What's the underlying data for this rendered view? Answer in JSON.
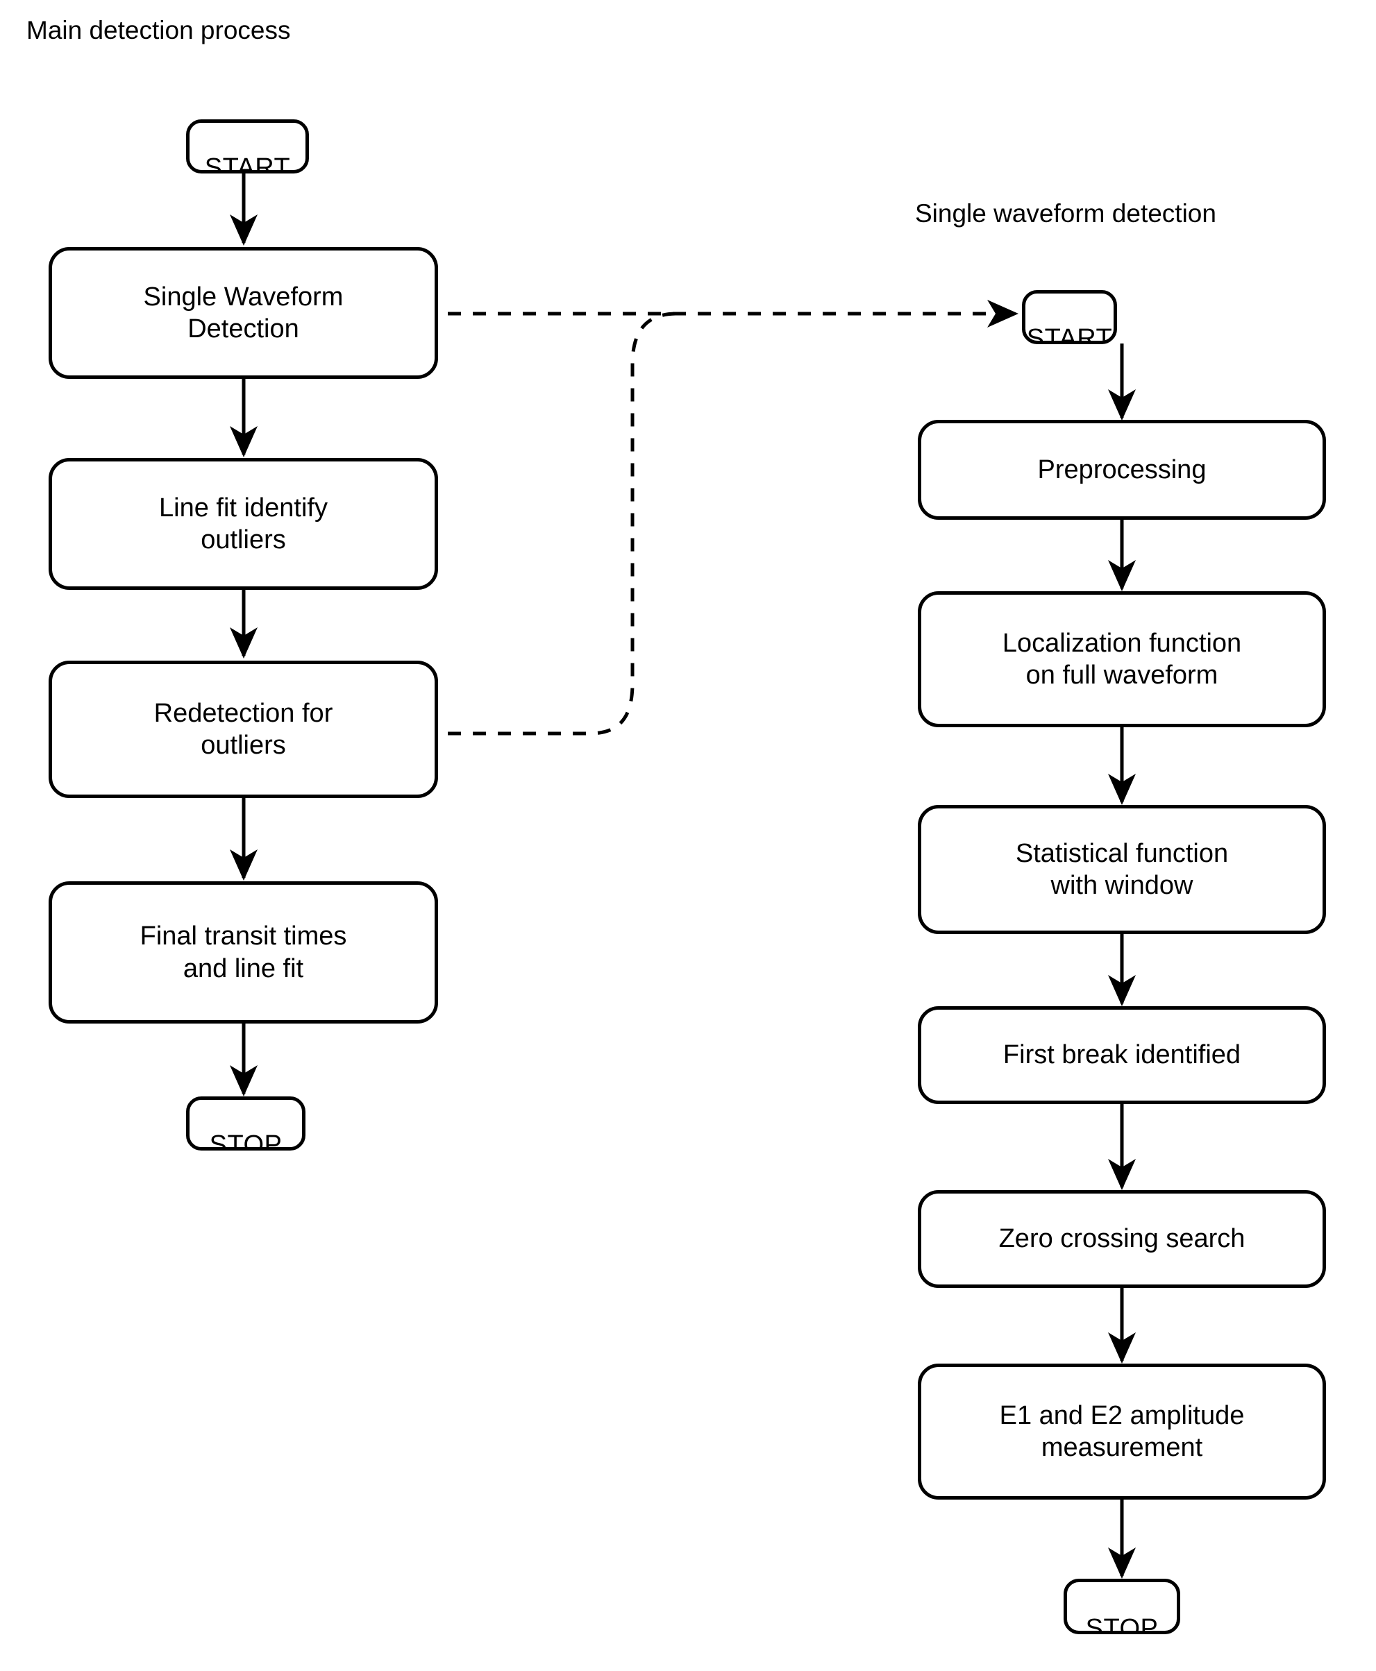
{
  "diagram": {
    "titles": {
      "main": "Main detection process",
      "right": "Single waveform detection"
    },
    "left_column": {
      "start": "START",
      "nodes": [
        {
          "id": "single-waveform-detection",
          "line1": "Single Waveform",
          "line2": "Detection"
        },
        {
          "id": "line-fit-identify-outliers",
          "line1": "Line fit identify",
          "line2": "outliers"
        },
        {
          "id": "redetection-for-outliers",
          "line1": "Redetection for",
          "line2": "outliers"
        },
        {
          "id": "final-transit-times-and-line-fit",
          "line1": "Final transit times",
          "line2": "and line fit"
        }
      ],
      "stop": "STOP"
    },
    "right_column": {
      "start": "START",
      "nodes": [
        {
          "id": "preprocessing",
          "line1": "Preprocessing",
          "line2": ""
        },
        {
          "id": "localization-function-on-full-waveform",
          "line1": "Localization function",
          "line2": "on full waveform"
        },
        {
          "id": "statistical-function-with-window",
          "line1": "Statistical function",
          "line2": "with window"
        },
        {
          "id": "first-break-identified",
          "line1": "First break identified",
          "line2": ""
        },
        {
          "id": "zero-crossing-search",
          "line1": "Zero crossing search",
          "line2": ""
        },
        {
          "id": "e1-and-e2-amplitude-measurement",
          "line1": "E1 and E2 amplitude",
          "line2": "measurement"
        }
      ],
      "stop": "STOP"
    },
    "connectors": {
      "style_solid": "solid-arrow",
      "style_dashed": "dashed-arrow",
      "dashed_call_label": "",
      "dashed_return_label": ""
    },
    "colors": {
      "stroke": "#000000",
      "background": "#ffffff"
    }
  }
}
